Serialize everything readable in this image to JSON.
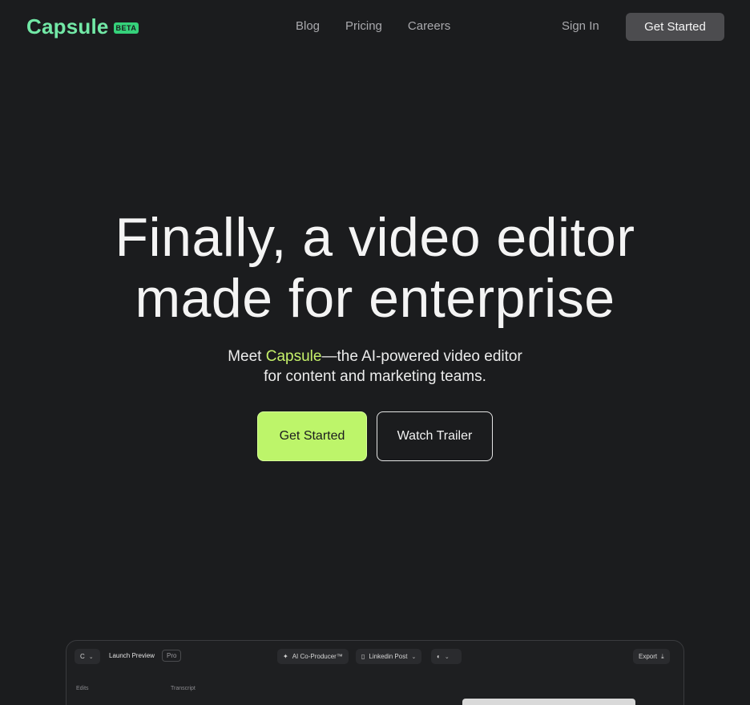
{
  "nav": {
    "logo": "Capsule",
    "badge": "BETA",
    "links": [
      "Blog",
      "Pricing",
      "Careers"
    ],
    "signin": "Sign In",
    "cta": "Get Started"
  },
  "hero": {
    "title_line1": "Finally, a video editor",
    "title_line2": "made for enterprise",
    "sub_prefix": "Meet ",
    "sub_highlight": "Capsule",
    "sub_rest": "—the AI-powered video editor",
    "sub_line2": "for content and marketing teams.",
    "primary_cta": "Get Started",
    "secondary_cta": "Watch Trailer"
  },
  "preview": {
    "workspace_initial": "C",
    "project_name": "Launch Preview",
    "plan_badge": "Pro",
    "ai_button": "AI Co-Producer™",
    "format_select": "Linkedin Post",
    "export_button": "Export",
    "edits_label": "Edits",
    "transcript_label": "Transcript"
  },
  "colors": {
    "background": "#1b1c1e",
    "logo": "#72e8a6",
    "accent": "#bdf56a",
    "highlight": "#c5f06a"
  }
}
